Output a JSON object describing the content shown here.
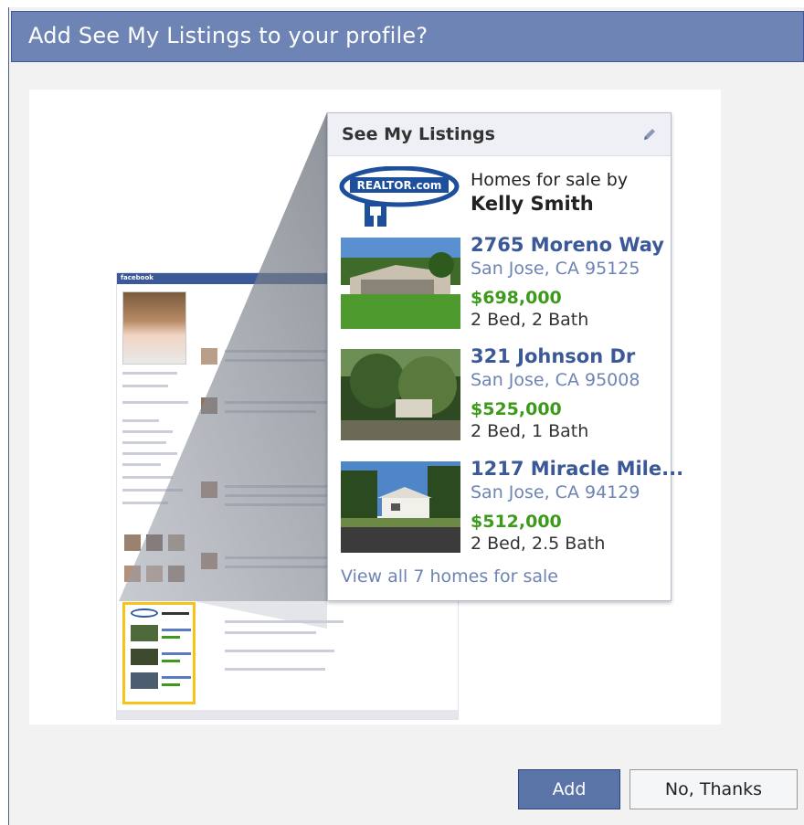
{
  "dialog": {
    "title": "Add See My Listings to your profile?"
  },
  "box": {
    "title": "See My Listings",
    "logo_text": "REALTOR.com",
    "homes_for_sale_by": "Homes for sale by",
    "agent_name": "Kelly Smith",
    "listings": [
      {
        "address": "2765 Moreno Way",
        "city": "San Jose, CA 95125",
        "price": "$698,000",
        "beds": "2 Bed, 2 Bath"
      },
      {
        "address": "321 Johnson Dr",
        "city": "San Jose, CA 95008",
        "price": "$525,000",
        "beds": "2 Bed, 1 Bath"
      },
      {
        "address": "1217 Miracle Mile...",
        "city": "San Jose, CA 94129",
        "price": "$512,000",
        "beds": "2 Bed, 2.5 Bath"
      }
    ],
    "view_all": "View all 7 homes for sale"
  },
  "mini_page": {
    "nav_label": "facebook"
  },
  "buttons": {
    "add": "Add",
    "no_thanks": "No, Thanks"
  },
  "colors": {
    "title_bar": "#6d84b4",
    "link_blue": "#3b5998",
    "price_green": "#3e9a1c",
    "highlight_yellow": "#f7c31a"
  }
}
